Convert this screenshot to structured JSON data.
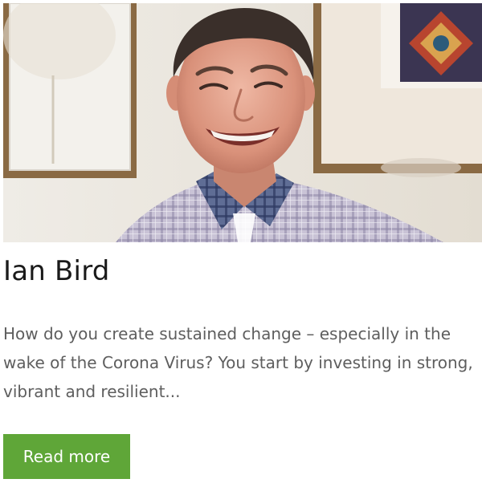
{
  "card": {
    "name": "Ian Bird",
    "excerpt": "How do you create sustained change – especially in the wake of the Corona Virus? You start by investing in strong, vibrant and resilient...",
    "read_more_label": "Read more",
    "button_color": "#5fa638"
  }
}
